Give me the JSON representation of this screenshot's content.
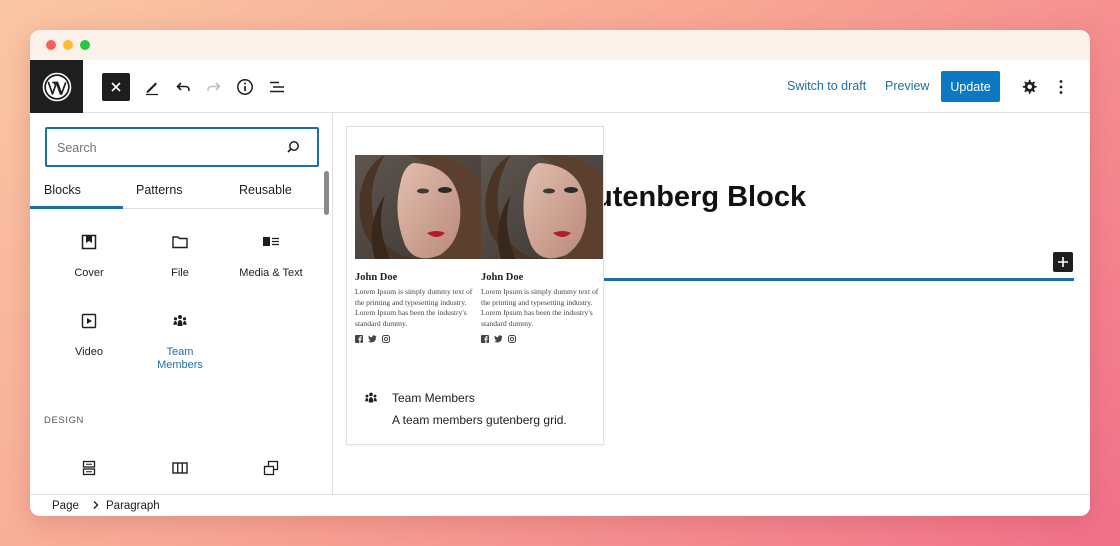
{
  "toolbar": {
    "switch_to_draft": "Switch to draft",
    "preview": "Preview",
    "update": "Update"
  },
  "search": {
    "placeholder": "Search",
    "value": ""
  },
  "tabs": [
    {
      "label": "Blocks",
      "active": true
    },
    {
      "label": "Patterns",
      "active": false
    },
    {
      "label": "Reusable",
      "active": false
    }
  ],
  "blocks": [
    {
      "label": "Cover",
      "icon": "cover-icon"
    },
    {
      "label": "File",
      "icon": "folder-icon"
    },
    {
      "label": "Media & Text",
      "icon": "media-text-icon"
    },
    {
      "label": "Video",
      "icon": "video-icon"
    },
    {
      "label": "Team Members",
      "icon": "team-icon",
      "active": true
    }
  ],
  "design_heading": "DESIGN",
  "design_icons": [
    "group-icon",
    "columns-icon",
    "stack-icon"
  ],
  "preview": {
    "members": [
      {
        "name": "John Doe",
        "bio": "Lorem Ipsum is simply dummy text of the printing and typesetting industry. Lorem Ipsum has been the industry's standard dummy."
      },
      {
        "name": "John Doe",
        "bio": "Lorem Ipsum is simply dummy text of the printing and typesetting industry. Lorem Ipsum has been the industry's standard dummy."
      }
    ],
    "block_title": "Team Members",
    "block_description": "A team members gutenberg grid."
  },
  "canvas": {
    "heading_visible": "utenberg Block"
  },
  "breadcrumb": {
    "page": "Page",
    "current": "Paragraph"
  },
  "colors": {
    "accent": "#1d6fa5",
    "update_bg": "#0a78c3",
    "dark": "#1e1e1e"
  }
}
